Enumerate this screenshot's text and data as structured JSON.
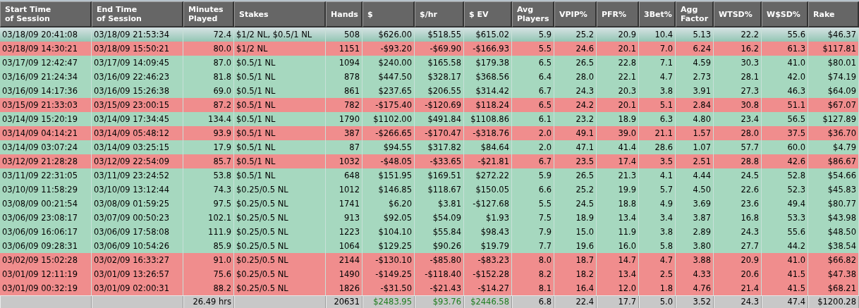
{
  "table": {
    "columns": [
      "Start Time\nof Session",
      "End Time\nof Session",
      "Minutes\nPlayed",
      "Stakes",
      "Hands",
      "$",
      "$/hr",
      "$ EV",
      "Avg\nPlayers",
      "VPIP%",
      "PFR%",
      "3Bet%",
      "Agg\nFactor",
      "WTSD%",
      "W$SD%",
      "Rake"
    ],
    "rows": [
      {
        "selected": true,
        "kind": "win",
        "cells": [
          "03/18/09 20:41:08",
          "03/18/09 21:53:34",
          "72.4",
          "$1/2 NL, $0.5/1 NL",
          "508",
          "$626.00",
          "$518.55",
          "$615.02",
          "5.9",
          "25.2",
          "20.9",
          "10.4",
          "5.13",
          "22.2",
          "55.6",
          "$46.37"
        ]
      },
      {
        "selected": false,
        "kind": "loss",
        "cells": [
          "03/18/09 14:30:21",
          "03/18/09 15:50:21",
          "80.0",
          "$1/2 NL",
          "1151",
          "-$93.20",
          "-$69.90",
          "-$166.93",
          "5.5",
          "24.6",
          "20.1",
          "7.0",
          "6.24",
          "16.2",
          "61.3",
          "$117.81"
        ]
      },
      {
        "selected": false,
        "kind": "win",
        "cells": [
          "03/17/09 12:42:47",
          "03/17/09 14:09:45",
          "87.0",
          "$0.5/1 NL",
          "1094",
          "$240.00",
          "$165.58",
          "$179.38",
          "6.5",
          "26.5",
          "22.8",
          "7.1",
          "4.59",
          "30.3",
          "41.0",
          "$80.01"
        ]
      },
      {
        "selected": false,
        "kind": "win",
        "cells": [
          "03/16/09 21:24:34",
          "03/16/09 22:46:23",
          "81.8",
          "$0.5/1 NL",
          "878",
          "$447.50",
          "$328.17",
          "$368.56",
          "6.4",
          "28.0",
          "22.1",
          "4.7",
          "2.73",
          "28.1",
          "42.0",
          "$74.19"
        ]
      },
      {
        "selected": false,
        "kind": "win",
        "cells": [
          "03/16/09 14:17:36",
          "03/16/09 15:26:38",
          "69.0",
          "$0.5/1 NL",
          "861",
          "$237.65",
          "$206.55",
          "$314.42",
          "6.7",
          "24.3",
          "20.3",
          "3.8",
          "3.91",
          "27.3",
          "46.3",
          "$64.09"
        ]
      },
      {
        "selected": false,
        "kind": "loss",
        "cells": [
          "03/15/09 21:33:03",
          "03/15/09 23:00:15",
          "87.2",
          "$0.5/1 NL",
          "782",
          "-$175.40",
          "-$120.69",
          "$118.24",
          "6.5",
          "24.2",
          "20.1",
          "5.1",
          "2.84",
          "30.8",
          "51.1",
          "$67.07"
        ]
      },
      {
        "selected": false,
        "kind": "win",
        "cells": [
          "03/14/09 15:20:19",
          "03/14/09 17:34:45",
          "134.4",
          "$0.5/1 NL",
          "1790",
          "$1102.00",
          "$491.84",
          "$1108.86",
          "6.1",
          "23.2",
          "18.9",
          "6.3",
          "4.80",
          "23.4",
          "56.5",
          "$127.89"
        ]
      },
      {
        "selected": false,
        "kind": "loss",
        "cells": [
          "03/14/09 04:14:21",
          "03/14/09 05:48:12",
          "93.9",
          "$0.5/1 NL",
          "387",
          "-$266.65",
          "-$170.47",
          "-$318.76",
          "2.0",
          "49.1",
          "39.0",
          "21.1",
          "1.57",
          "28.0",
          "37.5",
          "$36.70"
        ]
      },
      {
        "selected": false,
        "kind": "win",
        "cells": [
          "03/14/09 03:07:24",
          "03/14/09 03:25:15",
          "17.9",
          "$0.5/1 NL",
          "87",
          "$94.55",
          "$317.82",
          "$84.64",
          "2.0",
          "47.1",
          "41.4",
          "28.6",
          "1.07",
          "57.7",
          "60.0",
          "$4.79"
        ]
      },
      {
        "selected": false,
        "kind": "loss",
        "cells": [
          "03/12/09 21:28:28",
          "03/12/09 22:54:09",
          "85.7",
          "$0.5/1 NL",
          "1032",
          "-$48.05",
          "-$33.65",
          "-$21.81",
          "6.7",
          "23.5",
          "17.4",
          "3.5",
          "2.51",
          "28.8",
          "42.6",
          "$86.67"
        ]
      },
      {
        "selected": false,
        "kind": "win",
        "cells": [
          "03/11/09 22:31:05",
          "03/11/09 23:24:52",
          "53.8",
          "$0.5/1 NL",
          "648",
          "$151.95",
          "$169.51",
          "$272.22",
          "5.9",
          "26.5",
          "21.3",
          "4.1",
          "4.44",
          "24.5",
          "52.8",
          "$54.66"
        ]
      },
      {
        "selected": false,
        "kind": "win",
        "cells": [
          "03/10/09 11:58:29",
          "03/10/09 13:12:44",
          "74.3",
          "$0.25/0.5 NL",
          "1012",
          "$146.85",
          "$118.67",
          "$150.05",
          "6.6",
          "25.2",
          "19.9",
          "5.7",
          "4.50",
          "22.6",
          "52.3",
          "$45.83"
        ]
      },
      {
        "selected": false,
        "kind": "win",
        "cells": [
          "03/08/09 00:21:54",
          "03/08/09 01:59:25",
          "97.5",
          "$0.25/0.5 NL",
          "1741",
          "$6.20",
          "$3.81",
          "-$127.68",
          "5.5",
          "24.5",
          "18.8",
          "4.9",
          "3.69",
          "23.6",
          "49.4",
          "$80.77"
        ]
      },
      {
        "selected": false,
        "kind": "win",
        "cells": [
          "03/06/09 23:08:17",
          "03/07/09 00:50:23",
          "102.1",
          "$0.25/0.5 NL",
          "913",
          "$92.05",
          "$54.09",
          "$1.93",
          "7.5",
          "18.9",
          "13.4",
          "3.4",
          "3.87",
          "16.8",
          "53.3",
          "$43.98"
        ]
      },
      {
        "selected": false,
        "kind": "win",
        "cells": [
          "03/06/09 16:06:17",
          "03/06/09 17:58:08",
          "111.9",
          "$0.25/0.5 NL",
          "1223",
          "$104.10",
          "$55.84",
          "$98.43",
          "7.9",
          "15.0",
          "11.9",
          "3.8",
          "2.89",
          "24.3",
          "55.6",
          "$48.50"
        ]
      },
      {
        "selected": false,
        "kind": "win",
        "cells": [
          "03/06/09 09:28:31",
          "03/06/09 10:54:26",
          "85.9",
          "$0.25/0.5 NL",
          "1064",
          "$129.25",
          "$90.26",
          "$19.79",
          "7.7",
          "19.6",
          "16.0",
          "5.8",
          "3.80",
          "27.7",
          "44.2",
          "$38.54"
        ]
      },
      {
        "selected": false,
        "kind": "loss",
        "cells": [
          "03/02/09 15:02:28",
          "03/02/09 16:33:27",
          "91.0",
          "$0.25/0.5 NL",
          "2144",
          "-$130.10",
          "-$85.80",
          "-$83.23",
          "8.0",
          "18.7",
          "14.7",
          "4.7",
          "3.88",
          "20.9",
          "41.0",
          "$66.82"
        ]
      },
      {
        "selected": false,
        "kind": "loss",
        "cells": [
          "03/01/09 12:11:19",
          "03/01/09 13:26:57",
          "75.6",
          "$0.25/0.5 NL",
          "1490",
          "-$149.25",
          "-$118.40",
          "-$152.28",
          "8.2",
          "18.2",
          "13.4",
          "2.5",
          "4.33",
          "20.6",
          "41.5",
          "$47.38"
        ]
      },
      {
        "selected": false,
        "kind": "loss",
        "cells": [
          "03/01/09 00:32:19",
          "03/01/09 02:00:31",
          "88.2",
          "$0.25/0.5 NL",
          "1826",
          "-$31.50",
          "-$21.43",
          "-$14.27",
          "8.1",
          "16.4",
          "12.0",
          "1.8",
          "4.76",
          "21.4",
          "41.5",
          "$68.21"
        ]
      }
    ],
    "totals": [
      {
        "kind": "blank"
      },
      {
        "kind": "blank"
      },
      {
        "kind": "value",
        "text": "26.49 hrs",
        "positive": false
      },
      {
        "kind": "blank"
      },
      {
        "kind": "value",
        "text": "20631",
        "positive": false
      },
      {
        "kind": "value",
        "text": "$2483.95",
        "positive": true
      },
      {
        "kind": "value",
        "text": "$93.76",
        "positive": true
      },
      {
        "kind": "value",
        "text": "$2446.58",
        "positive": true
      },
      {
        "kind": "value",
        "text": "6.8",
        "positive": false
      },
      {
        "kind": "value",
        "text": "22.4",
        "positive": false
      },
      {
        "kind": "value",
        "text": "17.7",
        "positive": false
      },
      {
        "kind": "value",
        "text": "5.0",
        "positive": false
      },
      {
        "kind": "value",
        "text": "3.52",
        "positive": false
      },
      {
        "kind": "value",
        "text": "24.3",
        "positive": false
      },
      {
        "kind": "value",
        "text": "47.4",
        "positive": false
      },
      {
        "kind": "value",
        "text": "$1200.28",
        "positive": false
      }
    ]
  }
}
